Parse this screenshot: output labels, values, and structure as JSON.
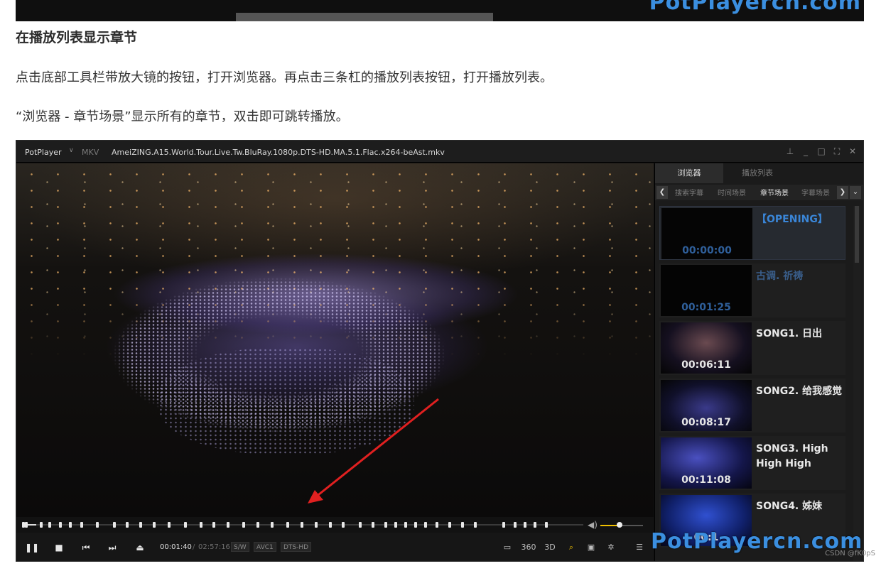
{
  "top_strip": {
    "brand": "PotPlayercn.com"
  },
  "article": {
    "heading": "在播放列表显示章节",
    "para1": "点击底部工具栏带放大镜的按钮，打开浏览器。再点击三条杠的播放列表按钮，打开播放列表。",
    "para2": "“浏览器 - 章节场景”显示所有的章节，双击即可跳转播放。"
  },
  "player": {
    "app_name": "PotPlayer",
    "app_caret": "∨",
    "format": "MKV",
    "filename": "AmeiZING.A15.World.Tour.Live.Tw.BluRay.1080p.DTS-HD.MA.5.1.Flac.x264-beAst.mkv",
    "window_controls": [
      "pin-icon",
      "minimize-icon",
      "maximize-icon",
      "fullscreen-icon",
      "close-icon"
    ],
    "time_current": "00:01:40",
    "time_separator": "/",
    "time_total": "02:57:16",
    "tags": [
      "S/W",
      "AVC1",
      "DTS-HD"
    ],
    "volume_level": 0.45,
    "seek_progress": 0.01,
    "controls": [
      "pause-icon",
      "stop-icon",
      "previous-icon",
      "next-icon",
      "eject-icon"
    ],
    "right_icons": {
      "screen": "screen-icon",
      "vr360": "360",
      "three_d": "3D",
      "browser": "browser-search-icon",
      "capture": "capture-icon",
      "settings": "settings-icon",
      "playlist": "playlist-icon"
    },
    "side_tabs": [
      "浏览器",
      "播放列表"
    ],
    "sub_tabs": [
      "搜索字幕",
      "时间场景",
      "章节场景",
      "字幕场景"
    ],
    "active_sub_tab": "章节场景",
    "chapters": [
      {
        "time": "00:00:00",
        "title": "【OPENING】"
      },
      {
        "time": "00:01:25",
        "title": "古调. 祈祷"
      },
      {
        "time": "00:06:11",
        "title": "SONG1. 日出"
      },
      {
        "time": "00:08:17",
        "title": "SONG2. 给我感觉"
      },
      {
        "time": "00:11:08",
        "title": "SONG3. High High High"
      },
      {
        "time": "00:1",
        "title": "SONG4. 姊妹"
      }
    ]
  },
  "watermark": "PotPlayercn.com",
  "credit": "CSDN @fK0pS",
  "colors": {
    "accent_blue": "#3b8fe0",
    "arrow_red": "#e02020",
    "volume_yellow": "#f0c000"
  }
}
